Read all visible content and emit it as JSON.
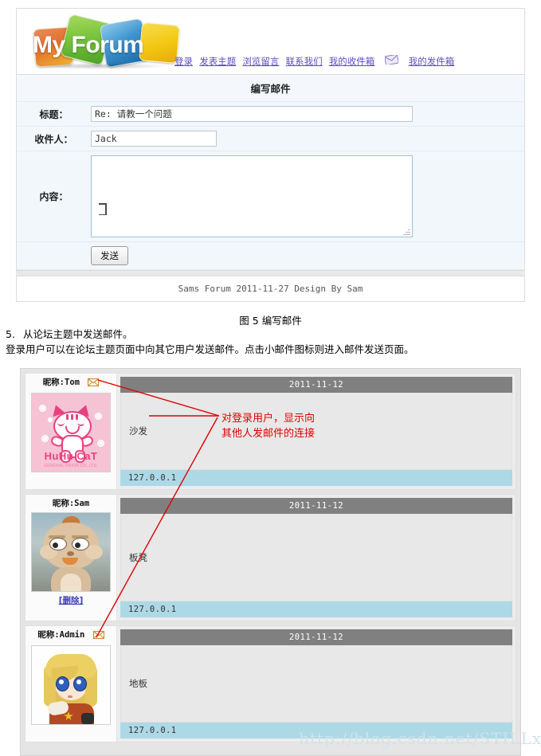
{
  "site": {
    "logo_text": "My Forum",
    "nav": [
      {
        "label": "登录",
        "name": "nav-login"
      },
      {
        "label": "发表主题",
        "name": "nav-post-topic"
      },
      {
        "label": "浏览留言",
        "name": "nav-browse-messages"
      },
      {
        "label": "联系我们",
        "name": "nav-contact-us"
      },
      {
        "label": "我的收件箱",
        "name": "nav-inbox"
      },
      {
        "label": "我的发件箱",
        "name": "nav-outbox"
      }
    ],
    "nav_icon": "envelope-icon",
    "footer": "Sams Forum 2011-11-27 Design By Sam"
  },
  "compose": {
    "title": "编写邮件",
    "subject_label": "标题：",
    "subject_value": "Re: 请教一个问题",
    "subject_placeholder": "",
    "to_label": "收件人：",
    "to_value": "Jack",
    "to_placeholder": "",
    "content_label": "内容：",
    "content_value": "",
    "content_placeholder": "",
    "send_label": "发送"
  },
  "figure_caption": "图 5 编写邮件",
  "doc": {
    "list_number": "5.",
    "list_item": "从论坛主题中发送邮件。",
    "paragraph": "登录用户可以在论坛主题页面中向其它用户发送邮件。点击小邮件图标则进入邮件发送页面。"
  },
  "annotation": {
    "line1": "对登录用户，显示向",
    "line2": "其他人发邮件的连接",
    "color": "#e00000"
  },
  "thread": {
    "posts": [
      {
        "nick": "昵称:Tom",
        "has_mail_icon": true,
        "has_delete": false,
        "delete_label": "",
        "avatar": "huhu-cat-avatar",
        "avatar_brand": "HuHu CaT",
        "avatar_sub": "GENERAL UNION CO.,LTD.",
        "date": "2011-11-12",
        "body": "沙发",
        "ip": "127.0.0.1"
      },
      {
        "nick": "昵称:Sam",
        "has_mail_icon": false,
        "has_delete": true,
        "delete_label": "[删除]",
        "avatar": "plush-cat-avatar",
        "avatar_brand": "",
        "avatar_sub": "",
        "date": "2011-11-12",
        "body": "板凳",
        "ip": "127.0.0.1"
      },
      {
        "nick": "昵称:Admin",
        "has_mail_icon": true,
        "has_delete": false,
        "delete_label": "",
        "avatar": "anime-girl-avatar",
        "avatar_brand": "",
        "avatar_sub": "",
        "date": "2011-11-12",
        "body": "地板",
        "ip": "127.0.0.1"
      }
    ]
  },
  "watermark": "http://blog.csdn.net/STILLxjy",
  "colors": {
    "date_bar": "#808080",
    "ip_bar": "#add8e6",
    "link": "#5b4ec0",
    "annotation": "#e00000"
  }
}
